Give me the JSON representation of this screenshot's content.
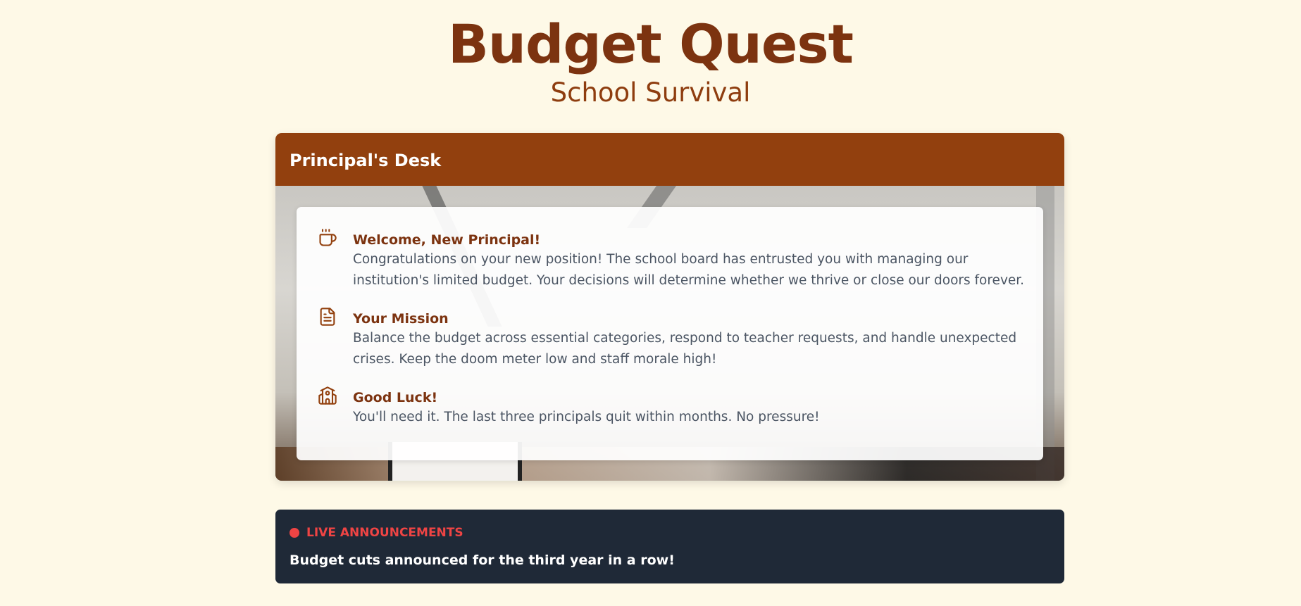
{
  "header": {
    "title": "Budget Quest",
    "subtitle": "School Survival"
  },
  "desk": {
    "title": "Principal's Desk",
    "items": [
      {
        "icon": "coffee-cup-icon",
        "title": "Welcome, New Principal!",
        "text": "Congratulations on your new position! The school board has entrusted you with managing our institution's limited budget. Your decisions will determine whether we thrive or close our doors forever."
      },
      {
        "icon": "document-icon",
        "title": "Your Mission",
        "text": "Balance the budget across essential categories, respond to teacher requests, and handle unexpected crises. Keep the doom meter low and staff morale high!"
      },
      {
        "icon": "school-building-icon",
        "title": "Good Luck!",
        "text": "You'll need it. The last three principals quit within months. No pressure!"
      }
    ]
  },
  "announcements": {
    "label": "LIVE ANNOUNCEMENTS",
    "message": "Budget cuts announced for the third year in a row!"
  },
  "colors": {
    "background": "#fef9e7",
    "brand_brown": "#92400e",
    "title_brown": "#7c3310",
    "announce_bg": "#1f2937",
    "live_red": "#ef4444"
  }
}
